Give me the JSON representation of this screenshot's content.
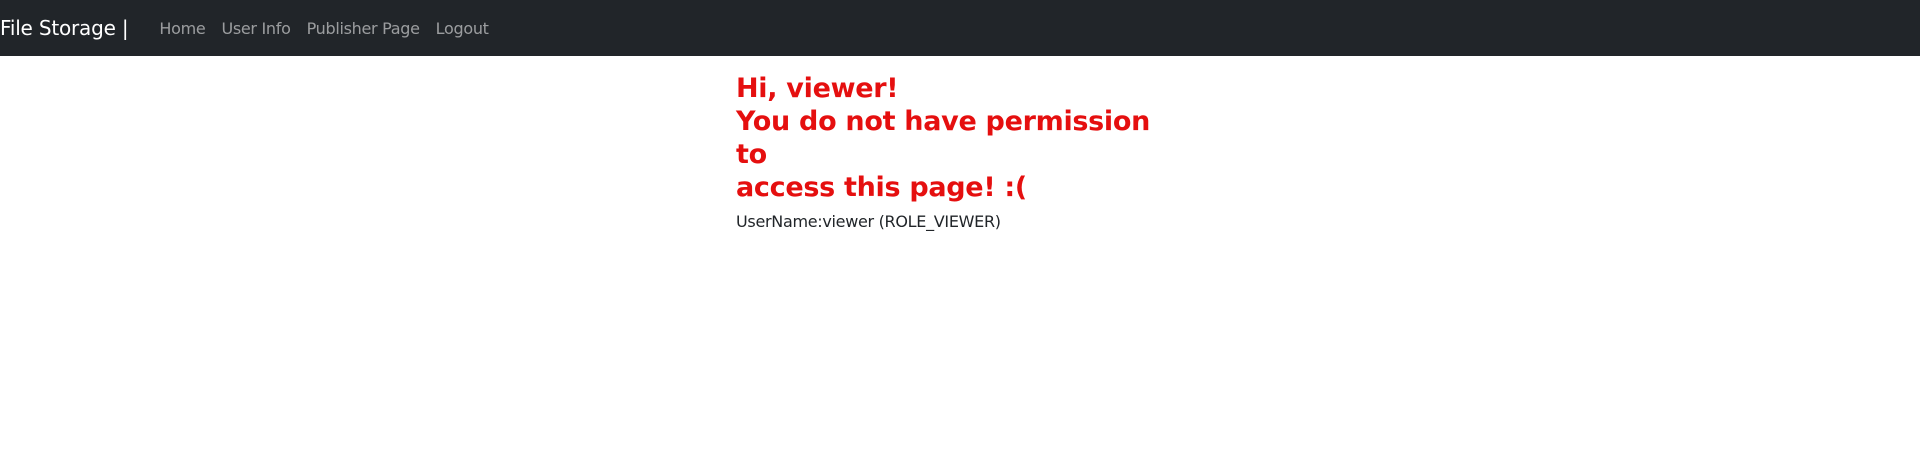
{
  "navbar": {
    "brand": "File Storage |",
    "links": [
      {
        "label": "Home"
      },
      {
        "label": "User Info"
      },
      {
        "label": "Publisher Page"
      },
      {
        "label": "Logout"
      }
    ]
  },
  "main": {
    "greeting": "Hi, viewer!",
    "message_line1": "You do not have permission to",
    "message_line2": "access this page! :(",
    "user_info": "UserName:viewer (ROLE_VIEWER)"
  },
  "colors": {
    "navbar_bg": "#212529",
    "error_text": "#e50f0f"
  }
}
